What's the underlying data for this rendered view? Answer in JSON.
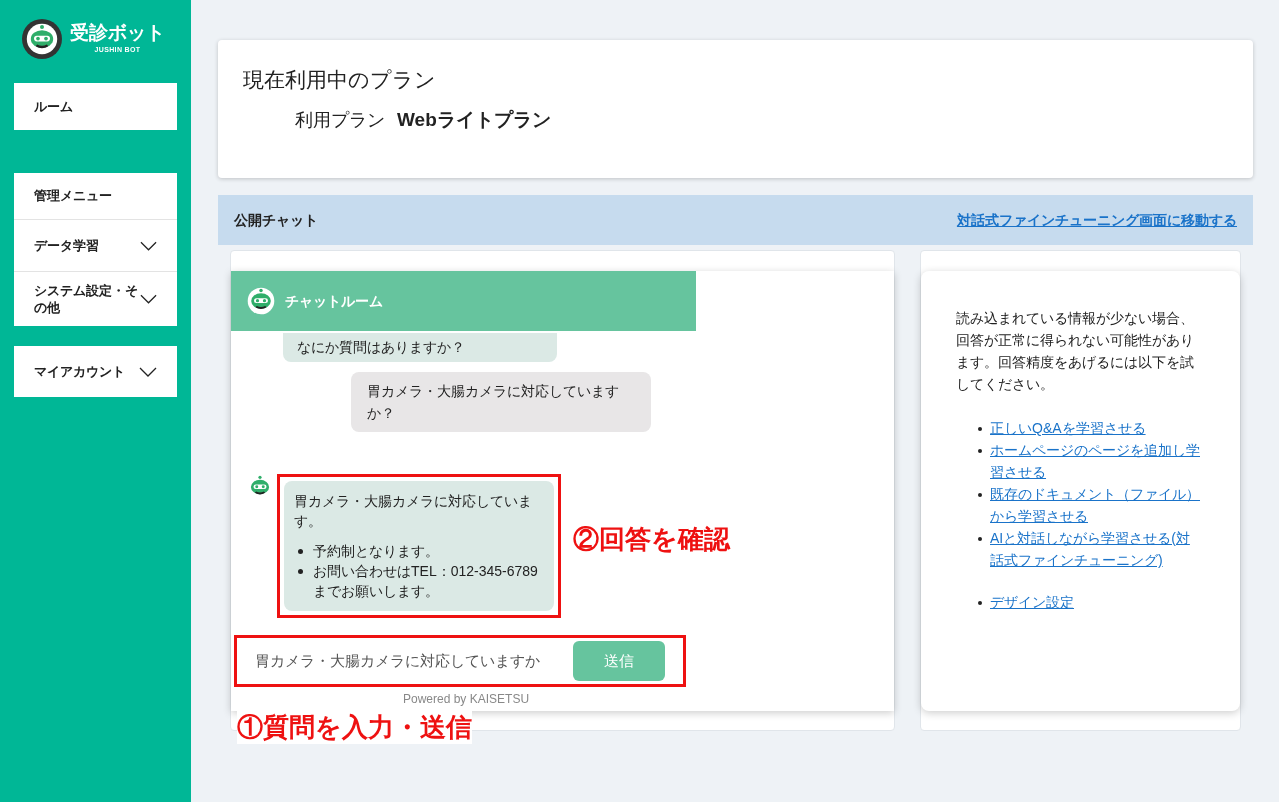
{
  "sidebar": {
    "logo_title": "受診ボット",
    "logo_subtitle": "JUSHIN BOT",
    "room": "ルーム",
    "menu_header": "管理メニュー",
    "items": [
      {
        "label": "データ学習",
        "expanded": false
      },
      {
        "label": "システム設定・その他",
        "expanded": false
      }
    ],
    "account": {
      "label": "マイアカウント",
      "expanded": false
    }
  },
  "plan": {
    "title": "現在利用中のプラン",
    "label": "利用プラン",
    "value": "Webライトプラン"
  },
  "public_chat": {
    "title": "公開チャット",
    "link": "対話式ファインチューニング画面に移動する"
  },
  "chat": {
    "title": "チャットルーム",
    "messages": [
      {
        "kind": "bot",
        "text": "なにか質問はありますか？"
      },
      {
        "kind": "user",
        "text": "胃カメラ・大腸カメラに対応していますか？"
      },
      {
        "kind": "bot_rich",
        "text": "胃カメラ・大腸カメラに対応しています。",
        "bullets": [
          "予約制となります。",
          "お問い合わせはTEL：012-345-6789までお願いします。"
        ]
      }
    ],
    "input": {
      "value": "胃カメラ・大腸カメラに対応していますか"
    },
    "send": "送信",
    "powered": "Powered by KAISETSU"
  },
  "annotations": {
    "answer": "②回答を確認",
    "question": "①質問を入力・送信"
  },
  "tips": {
    "text": "読み込まれている情報が少ない場合、回答が正常に得られない可能性があります。回答精度をあげるには以下を試してください。",
    "links": [
      "正しいQ&Aを学習させる",
      "ホームページのページを追加し学習させる",
      "既存のドキュメント（ファイル）から学習させる",
      "AIと対話しながら学習させる(対話式ファインチューニング)"
    ],
    "extra_links": [
      "デザイン設定"
    ]
  }
}
